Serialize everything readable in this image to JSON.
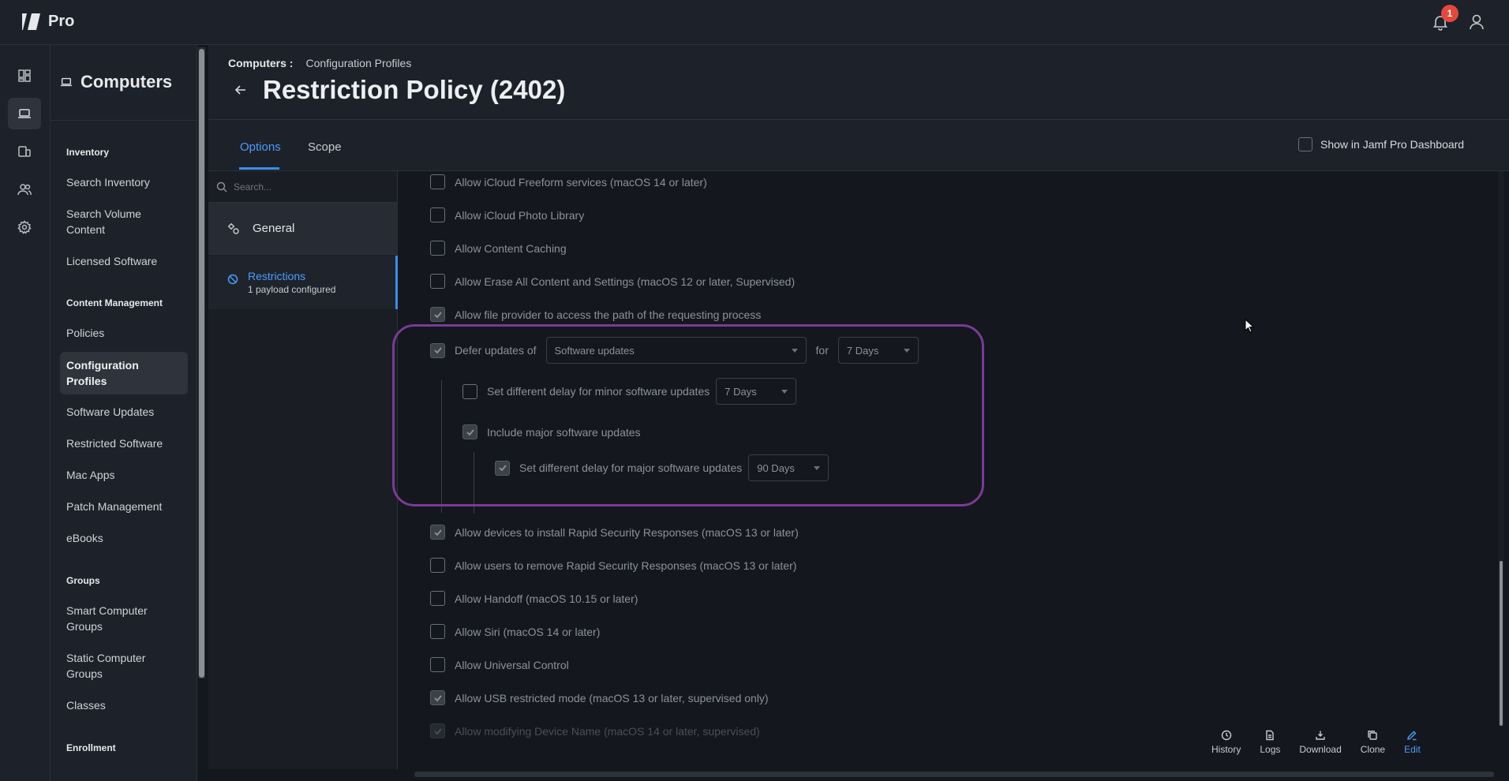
{
  "app": {
    "brand": "Pro",
    "notification_count": "1"
  },
  "nav": {
    "title": "Computers",
    "sections": [
      {
        "label": "Inventory",
        "items": [
          "Search Inventory",
          "Search Volume Content",
          "Licensed Software"
        ]
      },
      {
        "label": "Content Management",
        "items": [
          "Policies",
          "Configuration Profiles",
          "Software Updates",
          "Restricted Software",
          "Mac Apps",
          "Patch Management",
          "eBooks"
        ]
      },
      {
        "label": "Groups",
        "items": [
          "Smart Computer Groups",
          "Static Computer Groups",
          "Classes"
        ]
      },
      {
        "label": "Enrollment",
        "items": []
      }
    ],
    "active_item": "Configuration Profiles"
  },
  "header": {
    "breadcrumb_root": "Computers",
    "breadcrumb_sep": ":",
    "breadcrumb_current": "Configuration Profiles",
    "title": "Restriction Policy (2402)"
  },
  "tabs": {
    "options": "Options",
    "scope": "Scope",
    "show_dashboard": "Show in Jamf Pro Dashboard"
  },
  "side": {
    "search_placeholder": "Search...",
    "general": "General",
    "restrictions": "Restrictions",
    "restrictions_sub": "1 payload configured"
  },
  "rows": {
    "freeform": {
      "label": "Allow iCloud Freeform services (macOS 14 or later)",
      "checked": false
    },
    "photo": {
      "label": "Allow iCloud Photo Library",
      "checked": false
    },
    "caching": {
      "label": "Allow Content Caching",
      "checked": false
    },
    "erase": {
      "label": "Allow Erase All Content and Settings (macOS 12 or later, Supervised)",
      "checked": false
    },
    "fileprovider": {
      "label": "Allow file provider to access the path of the requesting process",
      "checked": true
    },
    "defer": {
      "label": "Defer updates of",
      "checked": true,
      "select": "Software updates",
      "for": "for",
      "days": "7 Days"
    },
    "minor": {
      "label": "Set different delay for minor software updates",
      "checked": false,
      "days": "7 Days"
    },
    "major": {
      "label": "Include major software updates",
      "checked": true
    },
    "majordelay": {
      "label": "Set different delay for major software updates",
      "checked": true,
      "days": "90 Days"
    },
    "rapid": {
      "label": "Allow devices to install Rapid Security Responses (macOS 13 or later)",
      "checked": true
    },
    "rapidremove": {
      "label": "Allow users to remove Rapid Security Responses (macOS 13 or later)",
      "checked": false
    },
    "handoff": {
      "label": "Allow Handoff (macOS 10.15 or later)",
      "checked": false
    },
    "siri": {
      "label": "Allow Siri (macOS 14 or later)",
      "checked": false
    },
    "universal": {
      "label": "Allow Universal Control",
      "checked": false
    },
    "usb": {
      "label": "Allow USB restricted mode (macOS 13 or later, supervised only)",
      "checked": true
    },
    "devicename": {
      "label": "Allow modifying Device Name (macOS 14 or later, supervised)",
      "checked": true
    }
  },
  "toolbar": {
    "history": "History",
    "logs": "Logs",
    "download": "Download",
    "clone": "Clone",
    "edit": "Edit"
  },
  "colors": {
    "accent": "#4a9dff",
    "highlight": "#7a3a98",
    "badge": "#e5483b"
  }
}
